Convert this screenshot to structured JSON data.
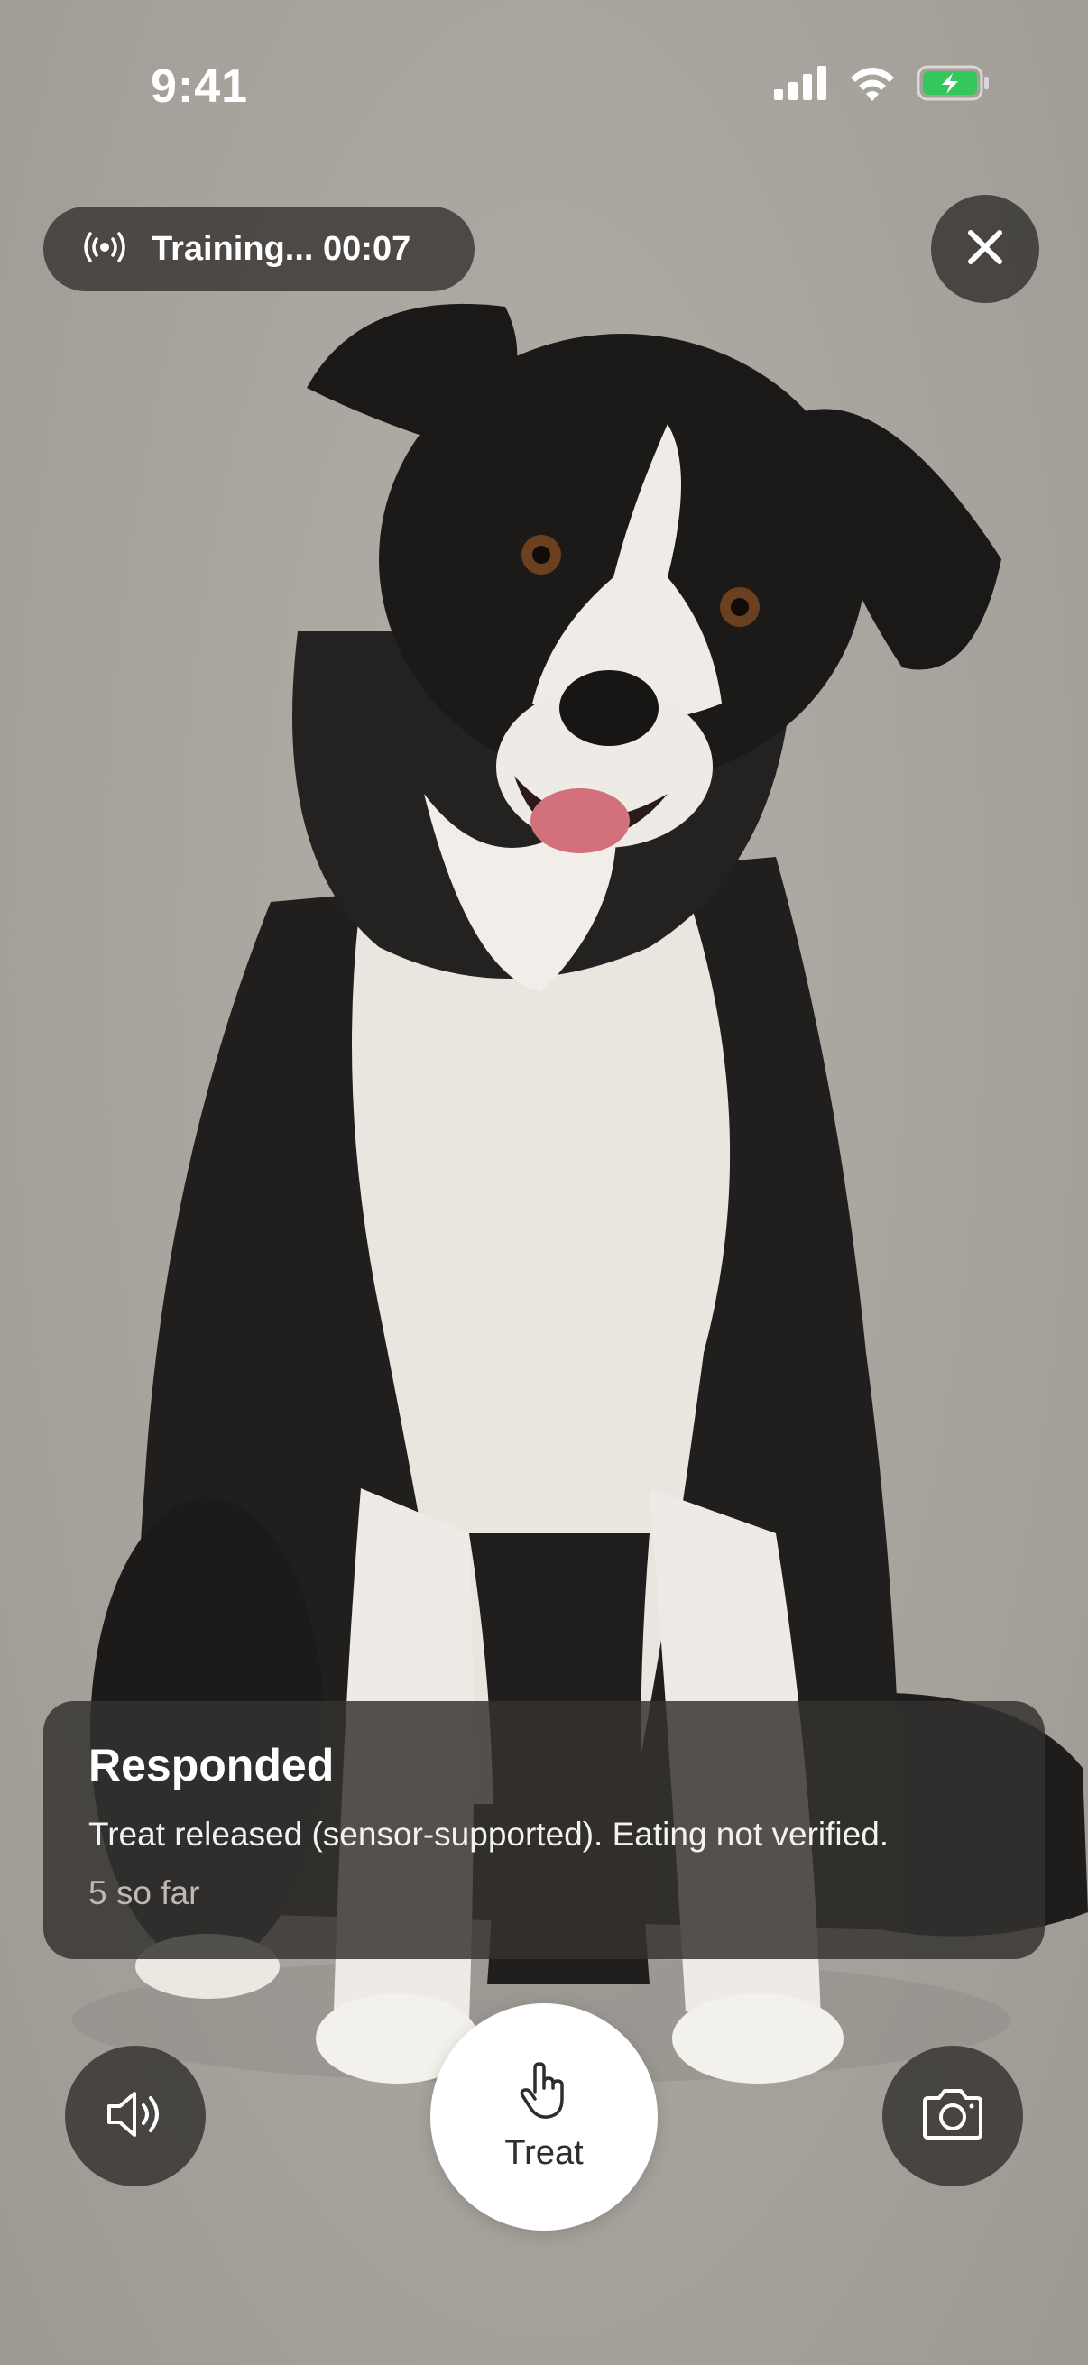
{
  "status_bar": {
    "time": "9:41",
    "icons": [
      "cellular-signal-icon",
      "wifi-icon",
      "battery-charging-icon"
    ],
    "battery_color": "#34c759"
  },
  "session": {
    "icon": "broadcast-icon",
    "label": "Training... 00:07"
  },
  "close_button": {
    "icon": "close-icon"
  },
  "response_card": {
    "title": "Responded",
    "detail": "Treat released (sensor-supported). Eating not verified.",
    "count": "5 so far"
  },
  "controls": {
    "sound_icon": "speaker-icon",
    "treat_icon": "hand-pointer-icon",
    "treat_label": "Treat",
    "camera_icon": "camera-icon"
  },
  "camera_feed": {
    "subject": "dog"
  }
}
